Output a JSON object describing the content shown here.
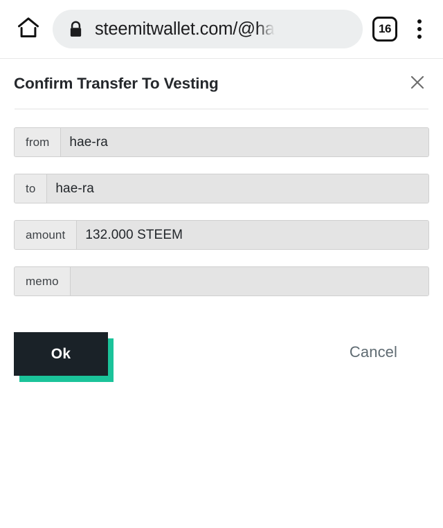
{
  "browser": {
    "home_icon": "home-icon",
    "lock_icon": "lock-icon",
    "url": "steemitwallet.com/@ha",
    "tab_count": "16",
    "menu_icon": "overflow-menu-icon"
  },
  "dialog": {
    "title": "Confirm Transfer To Vesting",
    "close_icon": "close-icon",
    "fields": [
      {
        "label": "from",
        "value": "hae-ra"
      },
      {
        "label": "to",
        "value": "hae-ra"
      },
      {
        "label": "amount",
        "value": "132.000 STEEM"
      },
      {
        "label": "memo",
        "value": ""
      }
    ],
    "actions": {
      "ok_label": "Ok",
      "cancel_label": "Cancel"
    }
  },
  "colors": {
    "accent_green": "#1bc39a",
    "button_dark": "#1a2228",
    "field_bg": "#e4e4e4",
    "field_label_bg": "#ebebeb",
    "field_border": "#cfcfcf",
    "omnibox_bg": "#eceeef",
    "cancel_text": "#5f6b72",
    "title_text": "#25282c"
  }
}
